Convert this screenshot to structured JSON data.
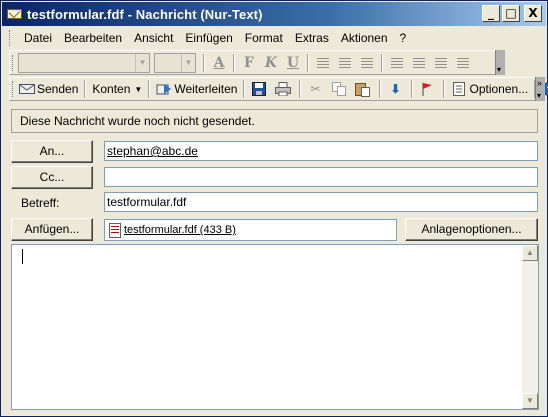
{
  "window": {
    "title": "testformular.fdf - Nachricht (Nur-Text)",
    "controls": {
      "minimize": "_",
      "maximize": "□",
      "close": "X"
    }
  },
  "menu": [
    {
      "label": "Datei"
    },
    {
      "label": "Bearbeiten"
    },
    {
      "label": "Ansicht"
    },
    {
      "label": "Einfügen"
    },
    {
      "label": "Format"
    },
    {
      "label": "Extras"
    },
    {
      "label": "Aktionen"
    },
    {
      "label": "?"
    }
  ],
  "format_toolbar": {
    "font_name": "",
    "font_size": "",
    "icons": [
      "font-color-icon",
      "bold-icon",
      "italic-icon",
      "underline-icon",
      "align-left-icon",
      "align-center-icon",
      "align-right-icon",
      "bullets-icon",
      "numbering-icon",
      "decrease-indent-icon",
      "increase-indent-icon"
    ]
  },
  "standard_toolbar": {
    "send": "Senden",
    "accounts": "Konten",
    "forward": "Weiterleiten",
    "options": "Optionen..."
  },
  "info": "Diese Nachricht wurde noch nicht gesendet.",
  "header": {
    "to_button": "An...",
    "to_value": "stephan@abc.de",
    "cc_button": "Cc...",
    "cc_value": "",
    "subject_label": "Betreff:",
    "subject_value": "testformular.fdf",
    "attach_button": "Anfügen...",
    "attachment": "testformular.fdf (433 B)",
    "attach_options_button": "Anlagenoptionen..."
  },
  "body": {
    "text": ""
  },
  "colors": {
    "title_start": "#0a246a",
    "title_end": "#a6caf0",
    "chrome": "#ece9d8"
  }
}
